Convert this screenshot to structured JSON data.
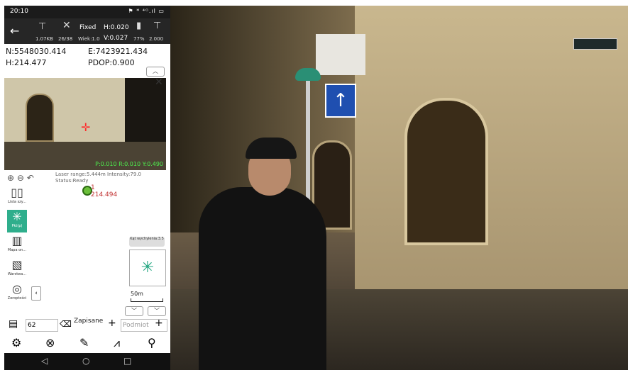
{
  "status_bar": {
    "time": "20:10",
    "icons": "⚑ * ⁴ᴳ.ıl ▭"
  },
  "app_bar": {
    "size": "1.07KB",
    "sats": "26/38",
    "fix": "Fixed",
    "age": "Wiek:1.0",
    "h_prec": "H:0.020",
    "v_prec": "V:0.027",
    "battery": "77%",
    "pole_height": "2.000"
  },
  "coords": {
    "n": "N:5548030.414",
    "e": "E:7423921.434",
    "h": "H:214.477",
    "pdop": "PDOP:0.900"
  },
  "camera": {
    "readout": "P:0.010 R:0.010 Y:0.490"
  },
  "laser": {
    "line1": "Laser range:5.444m Intensity:79.0",
    "line2": "Status:Ready"
  },
  "tools": [
    {
      "label": "Lista szy...",
      "icon": "▯▯"
    },
    {
      "label": "Pkt(p)",
      "icon": "✳"
    },
    {
      "label": "Mapa on...",
      "icon": "▥"
    },
    {
      "label": "Warstwa...",
      "icon": "▧"
    },
    {
      "label": "Zeroptości",
      "icon": "◎"
    }
  ],
  "map": {
    "point_name": "1",
    "point_height": "214.494",
    "angle_label": "Kąt wychylenia:3.5",
    "scale": "50m"
  },
  "input_row": {
    "number": "62",
    "saved": "Zapisane",
    "subject_placeholder": "Podmiot"
  }
}
